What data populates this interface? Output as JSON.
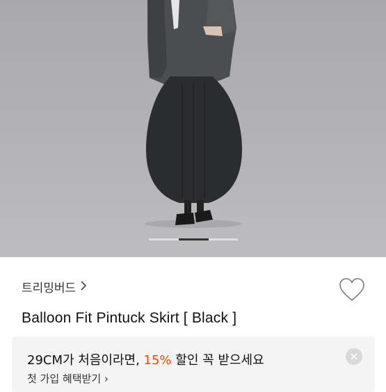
{
  "product": {
    "brand": "트리밍버드",
    "title": "Balloon Fit Pintuck Skirt [ Black ]",
    "image_alt": "Model wearing black balloon skirt and grey blazer"
  },
  "carousel": {
    "total": 3,
    "active_index": 1
  },
  "promo": {
    "text_before": "29CM가 처음이라면, ",
    "percent": "15%",
    "text_after": " 할인 꼭 받으세요",
    "sub": "첫 가입 혜택받기 ›"
  },
  "icons": {
    "wishlist": "heart-outline-icon",
    "close": "close-icon",
    "brand_link": "chevron-right-icon"
  },
  "colors": {
    "accent": "#ff4800",
    "text": "#111111",
    "promo_bg": "#f4f4f4"
  }
}
